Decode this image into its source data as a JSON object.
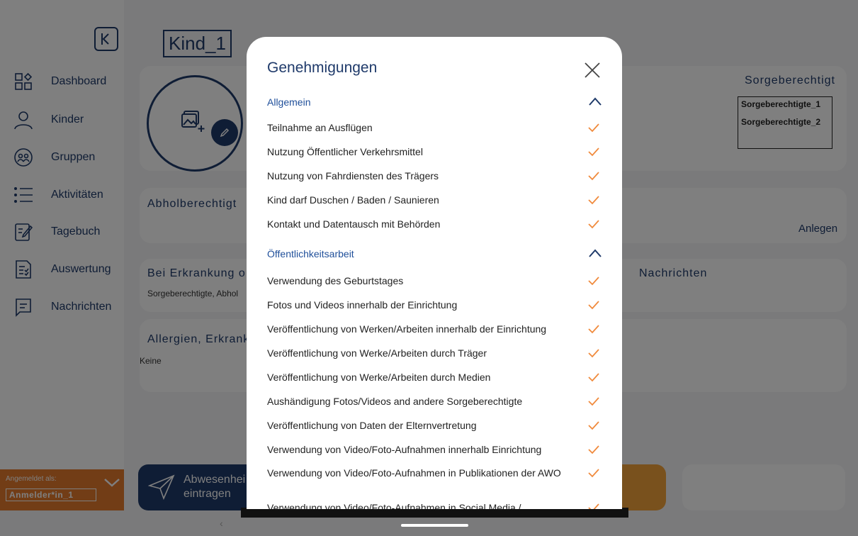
{
  "sidebar": {
    "items": [
      {
        "label": "Dashboard",
        "icon": "dashboard-icon"
      },
      {
        "label": "Kinder",
        "icon": "person-icon"
      },
      {
        "label": "Gruppen",
        "icon": "group-icon"
      },
      {
        "label": "Aktivitäten",
        "icon": "list-icon"
      },
      {
        "label": "Tagebuch",
        "icon": "edit-note-icon"
      },
      {
        "label": "Auswertung",
        "icon": "report-icon"
      },
      {
        "label": "Nachrichten",
        "icon": "message-icon"
      }
    ],
    "login_label": "Angemeldet als:",
    "login_user": "Anmelder*in_1"
  },
  "main": {
    "child_name": "Kind_1",
    "sorge_title": "Sorgeberechtigt",
    "sorge_items": [
      "Sorgeberechtigte_1",
      "Sorgeberechtigte_2"
    ],
    "abhol_title": "Abholberechtigt",
    "anlegen_label": "Anlegen",
    "erkrankung_title": "Bei Erkrankung o",
    "erkrankung_text": "Sorgeberechtigte, Abhol",
    "nachrichten_title": "Nachrichten",
    "allergien_title": "Allergien, Erkrank",
    "allergien_text": "Keine",
    "abwesenheit_label": "Abwesenhei\neintragen"
  },
  "modal": {
    "title": "Genehmigungen",
    "sections": [
      {
        "title": "Allgemein",
        "items": [
          "Teilnahme an Ausflügen",
          "Nutzung Öffentlicher Verkehrsmittel",
          "Nutzung von Fahrdiensten des Trägers",
          "Kind darf Duschen / Baden / Saunieren",
          "Kontakt und Datentausch mit Behörden"
        ]
      },
      {
        "title": "Öffentlichkeitsarbeit",
        "items": [
          "Verwendung des Geburtstages",
          "Fotos und Videos innerhalb der Einrichtung",
          "Veröffentlichung von Werken/Arbeiten innerhalb der Einrichtung",
          "Veröffentlichung von  Werke/Arbeiten durch Träger",
          "Veröffentlichung von Werke/Arbeiten durch Medien",
          "Aushändigung Fotos/Videos and andere Sorgeberechtigte",
          "Veröffentlichung von Daten der Elternvertretung",
          "Verwendung von Video/Foto-Aufnahmen innerhalb Einrichtung",
          "Verwendung von Video/Foto-Aufnahmen in Publikationen der AWO",
          "Verwendung von Video/Foto-Aufnahmen in Social Media /"
        ]
      }
    ]
  },
  "colors": {
    "primary": "#1f3a6a",
    "accent": "#e57a2c",
    "check": "#f08a3c"
  }
}
